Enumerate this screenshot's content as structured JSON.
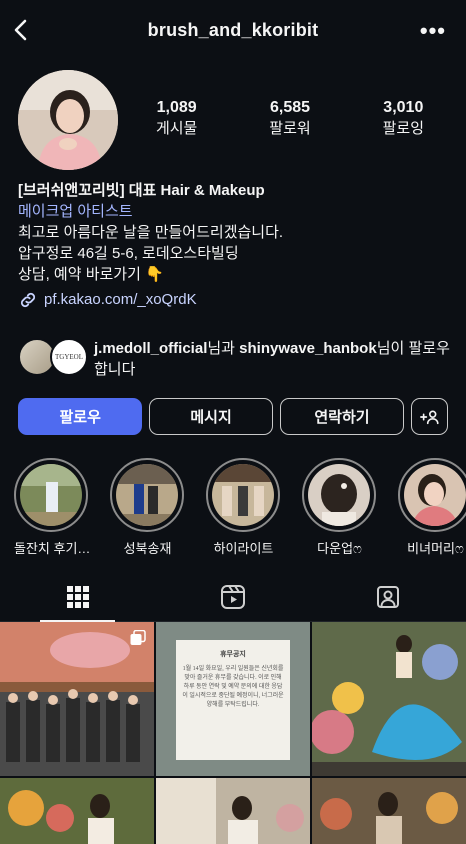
{
  "header": {
    "username": "brush_and_kkoribit"
  },
  "stats": [
    {
      "num": "1,089",
      "label": "게시물"
    },
    {
      "num": "6,585",
      "label": "팔로워"
    },
    {
      "num": "3,010",
      "label": "팔로잉"
    }
  ],
  "bio": {
    "name": "[브러쉬앤꼬리빗]  대표  Hair & Makeup",
    "category": "메이크업 아티스트",
    "lines": [
      "최고로 아름다운 날을 만들어드리겠습니다.",
      "압구정로 46길 5-6, 로데오스타빌딩",
      "상담, 예약 바로가기 👇"
    ],
    "link": "pf.kakao.com/_xoQrdK"
  },
  "followed_by": {
    "user1": "j.medoll_official",
    "mid": "님과 ",
    "user2": "shinywave_hanbok",
    "end": "님이 팔로우합니다",
    "badge_text": "TGYEOL"
  },
  "buttons": {
    "follow": "팔로우",
    "message": "메시지",
    "contact": "연락하기",
    "add": "+A"
  },
  "highlights": [
    {
      "label": "돌잔치 후기…"
    },
    {
      "label": "성북송재"
    },
    {
      "label": "하이라이트"
    },
    {
      "label": "다운업ෆ"
    },
    {
      "label": "비녀머리ෆ"
    }
  ],
  "notice": {
    "title": "휴무공지",
    "body": "1월 14일 화요일, 우리 일원들은 신년회를 맞아 즐거운 휴무를 갖습니다. 이로 인해 하루 동안 연락 및 예약 문의에 대한 응답이 일시적으로 중단될 예정이니, 너그러운 양해를 부탁드립니다."
  },
  "colors": {
    "accent": "#4f6bf0",
    "link": "#c9d4ff",
    "category": "#a4b6ff"
  }
}
